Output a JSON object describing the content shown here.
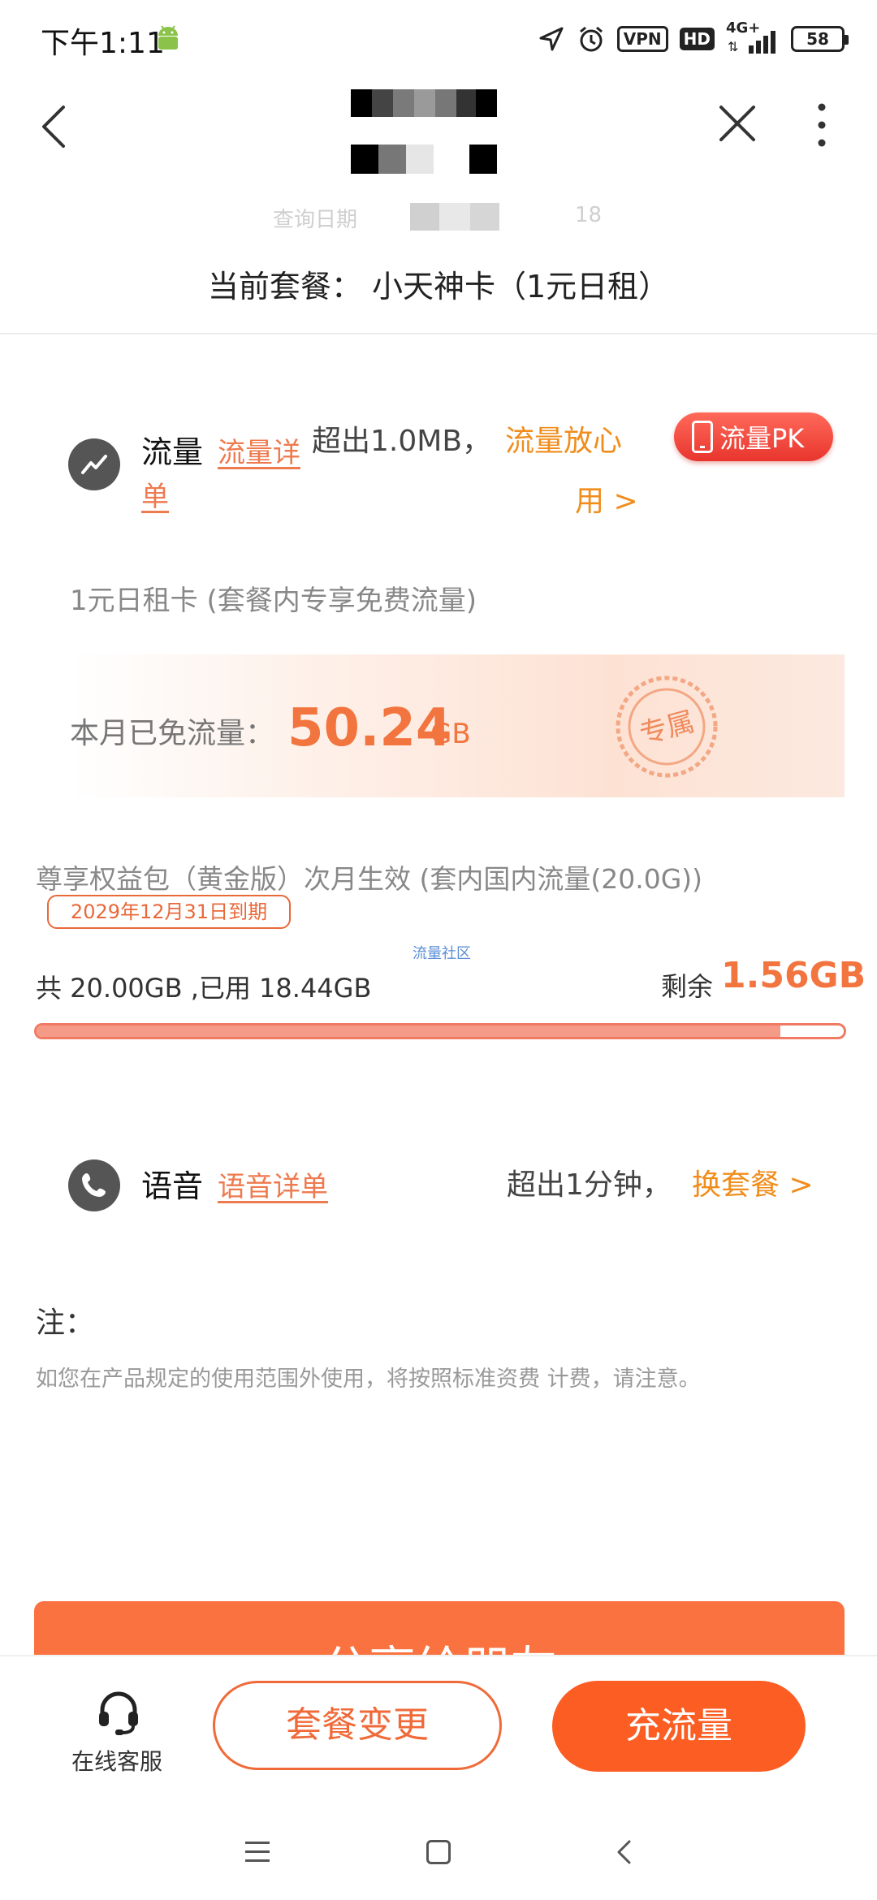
{
  "status_bar": {
    "time": "下午1:11",
    "icons": [
      "android-icon",
      "location-arrow-icon",
      "alarm-icon",
      "vpn-badge",
      "hd-badge",
      "signal-4g-icon",
      "battery-icon"
    ],
    "vpn": "VPN",
    "hd": "HD",
    "network": "4G+",
    "battery": "58"
  },
  "header": {
    "back_icon": "chevron-left-icon",
    "close_icon": "close-icon",
    "more_icon": "more-vertical-icon"
  },
  "query_date_text": "查询日期",
  "query_date_suffix": "18",
  "current_plan": "当前套餐： 小天神卡（1元日租）",
  "data_section": {
    "icon": "trend-line-icon",
    "title": "流量",
    "detail_link_1": "流量详",
    "detail_link_2": "单",
    "exceed_text": "超出1.0MB，",
    "worry_link_1": "流量放心",
    "worry_link_2": "用 >",
    "pk_button": "流量PK",
    "rent_note": "1元日租卡 (套餐内专享免费流量)",
    "free_label": "本月已免流量：",
    "free_value": "50.24",
    "free_unit": "GB",
    "stamp_text": "专属"
  },
  "gold_pack": {
    "title": "尊享权益包（黄金版）次月生效 (套内国内流量(20.0G))",
    "expire": "2029年12月31日到期",
    "watermark": "流量社区",
    "usage": "共 20.00GB ,已用 18.44GB",
    "remain_label": "剩余",
    "remain_value": "1.56GB",
    "used_fraction": 0.922
  },
  "voice_section": {
    "icon": "phone-icon",
    "title": "语音",
    "detail_link": "语音详单",
    "exceed_text": "超出1分钟，",
    "change_link": "换套餐 >"
  },
  "note": {
    "title": "注：",
    "text": "如您在产品规定的使用范围外使用，将按照标准资费 计费，请注意。"
  },
  "share_button": "分享给朋友",
  "bottom_bar": {
    "service_icon": "headset-icon",
    "service_label": "在线客服",
    "plan_change": "套餐变更",
    "topup": "充流量"
  },
  "colors": {
    "accent_orange": "#f2743f",
    "link_orange": "#ee7a4f",
    "highlight_yellow": "#f08d1c",
    "pk_red": "#e8352e",
    "primary_button": "#fb5d22"
  },
  "system_nav": {
    "icons": [
      "menu-icon",
      "home-square-icon",
      "back-triangle-icon"
    ]
  }
}
